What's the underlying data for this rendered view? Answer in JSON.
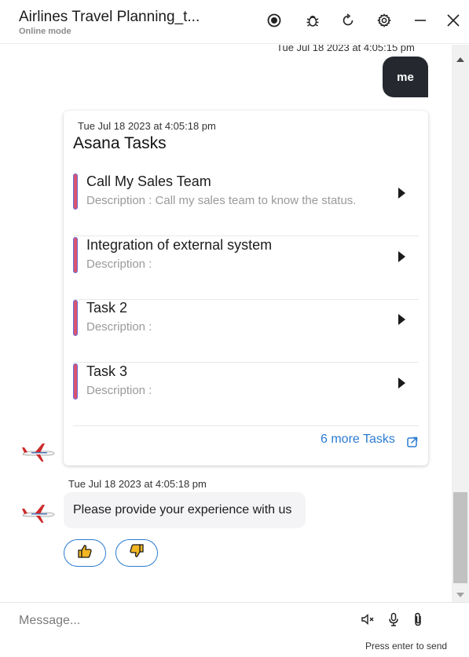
{
  "header": {
    "title": "Airlines Travel Planning_t...",
    "subtitle": "Online mode",
    "icons": [
      "record-icon",
      "bug-icon",
      "refresh-icon",
      "settings-icon",
      "minimize-icon",
      "close-icon"
    ]
  },
  "conversation": {
    "user_timestamp": "Tue Jul 18 2023 at 4:05:15 pm",
    "user_message": "me",
    "card": {
      "timestamp": "Tue Jul 18 2023 at 4:05:18 pm",
      "title": "Asana Tasks",
      "tasks": [
        {
          "name": "Call My Sales Team",
          "description": "Description : Call my sales team to know the status."
        },
        {
          "name": "Integration of external system",
          "description": "Description :"
        },
        {
          "name": "Task 2",
          "description": "Description :"
        },
        {
          "name": "Task 3",
          "description": "Description :"
        }
      ],
      "more_link": "6 more Tasks"
    },
    "bot_timestamp": "Tue Jul 18 2023 at 4:05:18 pm",
    "bot_message": "Please provide your experience with us",
    "feedback": {
      "positive_icon": "thumbs-up-icon",
      "negative_icon": "thumbs-down-icon"
    }
  },
  "composer": {
    "placeholder": "Message...",
    "hint": "Press enter to send",
    "icons": [
      "mute-icon",
      "microphone-icon",
      "attachment-icon"
    ]
  },
  "colors": {
    "accent": "#2b7bd1",
    "user_bubble": "#25292f",
    "task_bar": "#d9546f",
    "task_bar_border": "#6b6bd8"
  }
}
